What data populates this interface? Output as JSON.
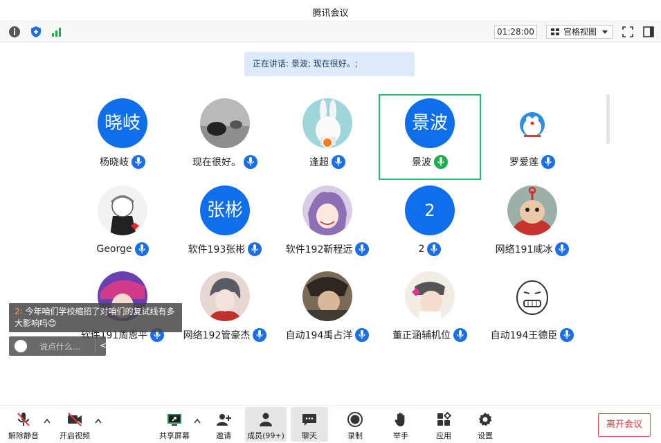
{
  "window": {
    "title": "腾讯会议"
  },
  "topbar": {
    "timer": "01:28:00",
    "view_label": "宫格视图"
  },
  "speaking": {
    "text": "正在讲话: 景波; 现在很好。;"
  },
  "participants": [
    {
      "name": "杨晓岐",
      "avatar_text": "晓岐"
    },
    {
      "name": "现在很好。"
    },
    {
      "name": "逢超"
    },
    {
      "name": "景波",
      "avatar_text": "景波"
    },
    {
      "name": "罗爱莲"
    },
    {
      "name": "George"
    },
    {
      "name": "软件193张彬",
      "avatar_text": "张彬"
    },
    {
      "name": "软件192靳程远"
    },
    {
      "name": "2",
      "avatar_text": "2"
    },
    {
      "name": "网络191咸冰"
    },
    {
      "name": "软件191周恩平"
    },
    {
      "name": "网络192管豪杰"
    },
    {
      "name": "自动194禹占洋"
    },
    {
      "name": "董正涵辅机位"
    },
    {
      "name": "自动194王德臣"
    }
  ],
  "chat": {
    "sender": "2:",
    "message": " 今年咱们学校缩招了对咱们的复试线有多大影响吗😊",
    "placeholder": "说点什么..."
  },
  "toolbar": {
    "unmute": "解除静音",
    "start_video": "开启视频",
    "share_screen": "共享屏幕",
    "invite": "邀请",
    "members": "成员(99+)",
    "chat": "聊天",
    "record": "录制",
    "raise_hand": "举手",
    "apps": "应用",
    "settings": "设置",
    "leave": "离开会议"
  },
  "colors": {
    "accent_blue": "#0f6eea",
    "active_border": "#2bb673",
    "leave_red": "#e84b4b"
  }
}
